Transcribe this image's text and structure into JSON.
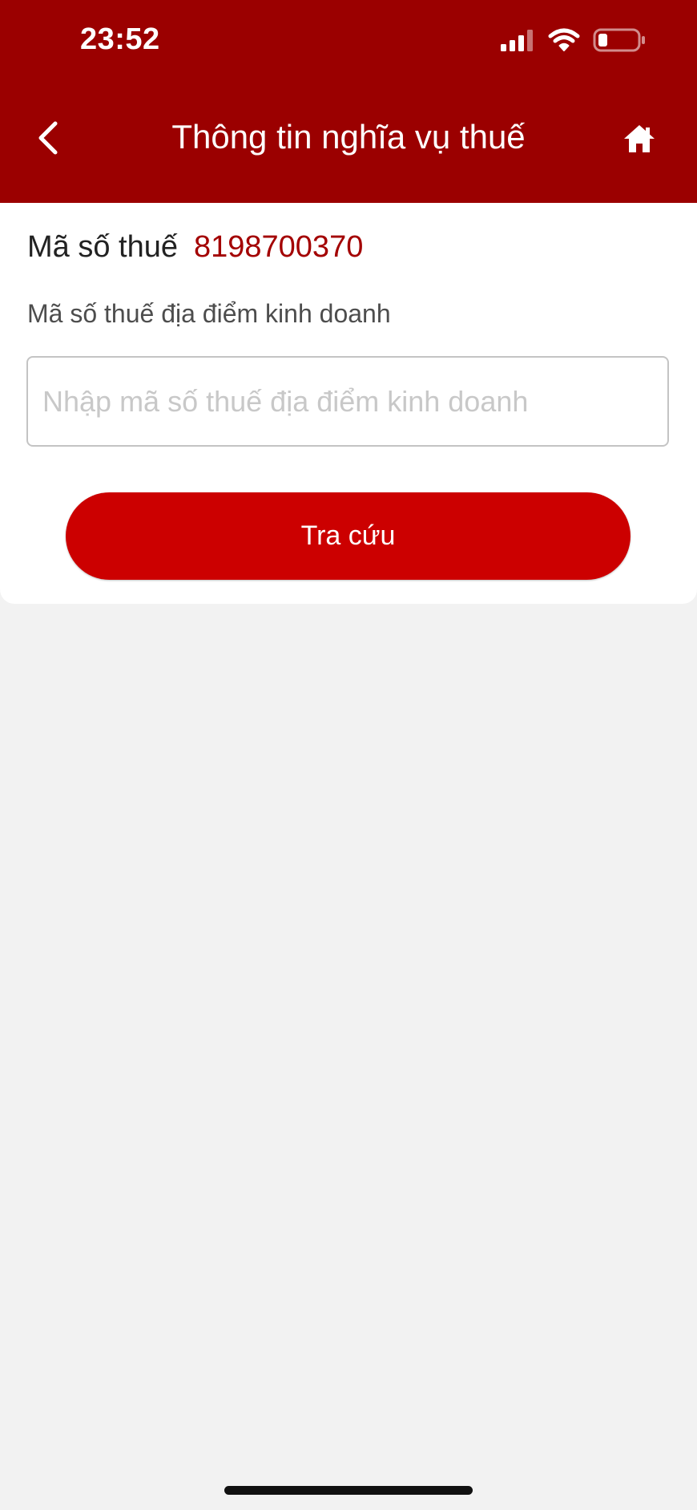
{
  "status_bar": {
    "time": "23:52",
    "icons": [
      "signal-icon",
      "wifi-icon",
      "battery-icon"
    ]
  },
  "header": {
    "title": "Thông tin nghĩa vụ thuế",
    "back_icon": "chevron-left-icon",
    "home_icon": "home-icon",
    "background_color": "#9b0000"
  },
  "form": {
    "tax_code_label": "Mã số thuế",
    "tax_code_value": "8198700370",
    "location_label": "Mã số thuế địa điểm kinh doanh",
    "location_input_value": "",
    "location_placeholder": "Nhập mã số thuế địa điểm kinh doanh",
    "submit_label": "Tra cứu"
  },
  "colors": {
    "accent": "#cc0000",
    "tax_value": "#a30000",
    "page_background": "#f2f2f2"
  }
}
